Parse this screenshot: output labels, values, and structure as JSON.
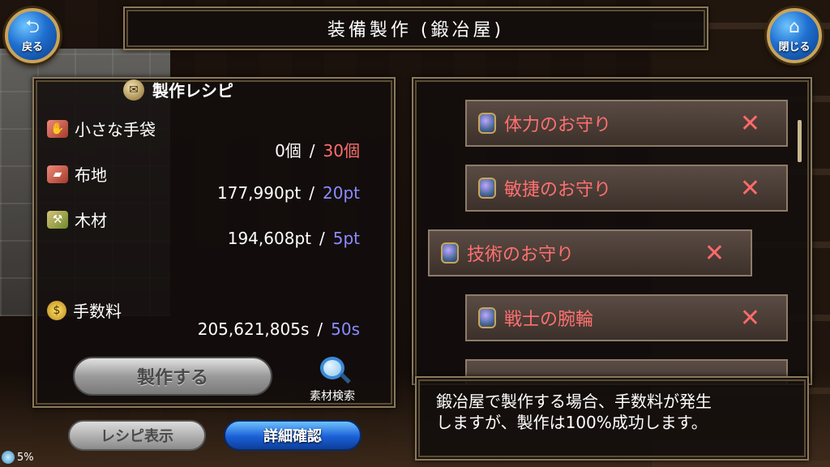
{
  "header": {
    "title": "装備製作 (鍛冶屋)",
    "back_label": "戻る",
    "close_label": "閉じる"
  },
  "recipe": {
    "heading": "製作レシピ",
    "materials": [
      {
        "name": "小さな手袋",
        "icon": "glove-icon",
        "have": "0個",
        "need": "30個",
        "need_color": "#ff6e6e"
      },
      {
        "name": "布地",
        "icon": "cloth-icon",
        "have": "177,990pt",
        "need": "20pt",
        "need_color": "#8c8cff"
      },
      {
        "name": "木材",
        "icon": "wood-icon",
        "have": "194,608pt",
        "need": "5pt",
        "need_color": "#8c8cff"
      }
    ],
    "fee": {
      "name": "手数料",
      "icon": "coin-icon",
      "have": "205,621,805s",
      "need": "50s",
      "need_color": "#8c8cff"
    },
    "slash": "/"
  },
  "buttons": {
    "make": "製作する",
    "search": "素材検索",
    "recipe_view": "レシピ表示",
    "detail": "詳細確認"
  },
  "status": {
    "percent": "5%"
  },
  "items": [
    {
      "name": "体力のお守り",
      "mark": "✕"
    },
    {
      "name": "敏捷のお守り",
      "mark": "✕"
    },
    {
      "name": "技術のお守り",
      "mark": "✕"
    },
    {
      "name": "戦士の腕輪",
      "mark": "✕"
    }
  ],
  "message": "鍛冶屋で製作する場合、手数料が発生\nしますが、製作は100%成功します。"
}
